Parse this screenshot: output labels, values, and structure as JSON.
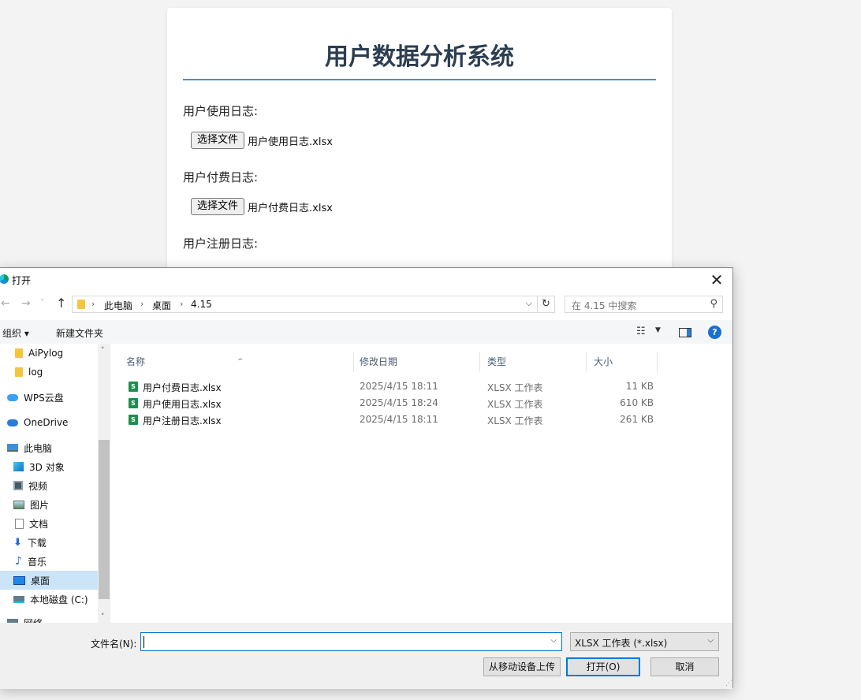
{
  "page": {
    "title": "用户数据分析系统",
    "fields": [
      {
        "label": "用户使用日志:",
        "button": "选择文件",
        "file": "用户使用日志.xlsx"
      },
      {
        "label": "用户付费日志:",
        "button": "选择文件",
        "file": "用户付费日志.xlsx"
      },
      {
        "label": "用户注册日志:"
      }
    ]
  },
  "dialog": {
    "title": "打开",
    "close": "✕",
    "nav": {
      "back": "←",
      "forward": "→",
      "recent": "˅",
      "up": "↑"
    },
    "breadcrumb": [
      "此电脑",
      "桌面",
      "4.15"
    ],
    "breadcrumb_sep": "›",
    "refresh": "↻",
    "dropdown": "⌵",
    "search_placeholder": "在 4.15 中搜索",
    "search_glyph": "⚲",
    "toolbar": {
      "organize": "组织 ▾",
      "new_folder": "新建文件夹",
      "view_glyph": "☷",
      "view_dd": "▼",
      "help": "?"
    },
    "nav_pane": [
      {
        "label": "AiPylog",
        "icon": "folder-icon"
      },
      {
        "label": "log",
        "icon": "folder-icon"
      },
      {
        "label": "WPS云盘",
        "icon": "wps-cloud-icon"
      },
      {
        "label": "OneDrive",
        "icon": "onedrive-cloud-icon"
      },
      {
        "label": "此电脑",
        "icon": "computer-icon"
      },
      {
        "label": "3D 对象",
        "icon": "3d-objects-icon"
      },
      {
        "label": "视频",
        "icon": "video-icon"
      },
      {
        "label": "图片",
        "icon": "pictures-icon"
      },
      {
        "label": "文档",
        "icon": "documents-icon"
      },
      {
        "label": "下载",
        "icon": "download-icon"
      },
      {
        "label": "音乐",
        "icon": "music-icon"
      },
      {
        "label": "桌面",
        "icon": "desktop-icon",
        "selected": true
      },
      {
        "label": "本地磁盘 (C:)",
        "icon": "local-disk-icon"
      },
      {
        "label": "网络",
        "icon": "network-icon"
      }
    ],
    "scroll": {
      "up": "˄",
      "down": "˅"
    },
    "columns": {
      "name": "名称",
      "sort_arrow": "^",
      "modified": "修改日期",
      "type": "类型",
      "size": "大小"
    },
    "files": [
      {
        "name": "用户付费日志.xlsx",
        "modified": "2025/4/15 18:11",
        "type": "XLSX 工作表",
        "size": "11 KB"
      },
      {
        "name": "用户使用日志.xlsx",
        "modified": "2025/4/15 18:24",
        "type": "XLSX 工作表",
        "size": "610 KB"
      },
      {
        "name": "用户注册日志.xlsx",
        "modified": "2025/4/15 18:11",
        "type": "XLSX 工作表",
        "size": "261 KB"
      }
    ],
    "excel_glyph": "S",
    "filename_label": "文件名(N):",
    "filename_value": "",
    "file_type": "XLSX 工作表 (*.xlsx)",
    "upload_button": "从移动设备上传",
    "open_button": "打开(O)",
    "cancel_button": "取消",
    "grip": "⋰"
  },
  "colors": {
    "title": "#2c3e50",
    "title_rule": "#3498db",
    "accent": "#0078d7",
    "selected": "#cce4f7"
  }
}
